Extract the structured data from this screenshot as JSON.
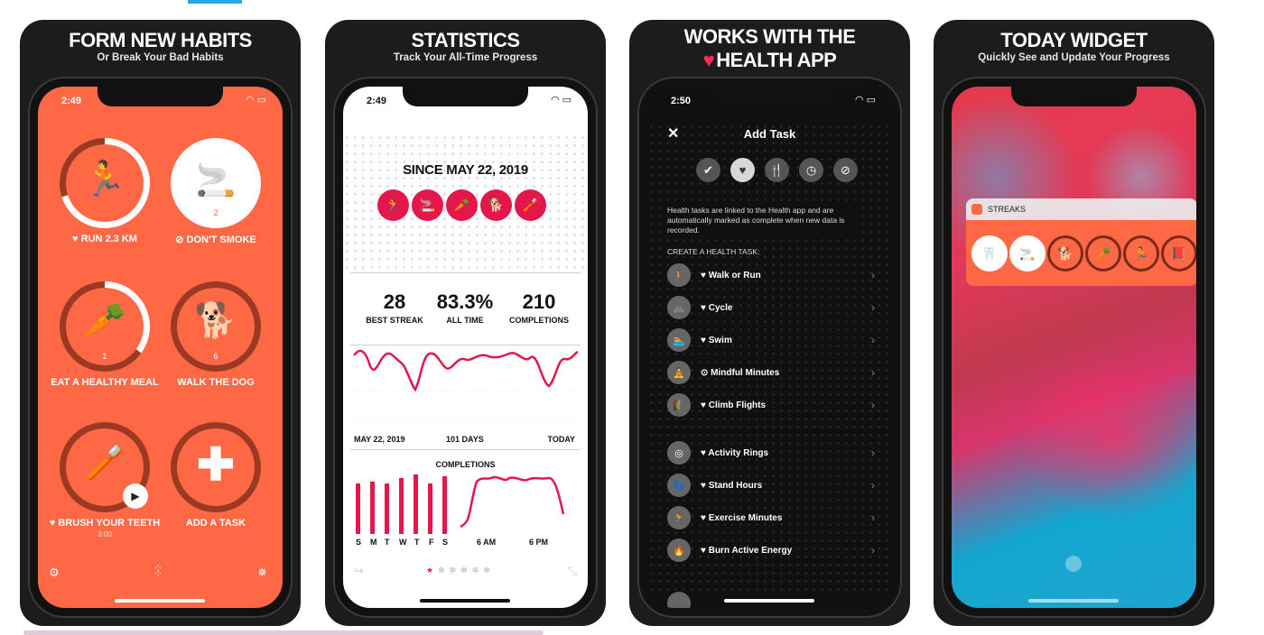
{
  "panels": [
    {
      "title": "FORM NEW HABITS",
      "subtitle": "Or Break Your Bad Habits"
    },
    {
      "title": "STATISTICS",
      "subtitle": "Track Your All-Time Progress"
    },
    {
      "title_line1": "WORKS WITH THE",
      "title_line2": "HEALTH APP"
    },
    {
      "title": "TODAY WIDGET",
      "subtitle": "Quickly See and Update Your Progress"
    }
  ],
  "screen1": {
    "time": "2:49",
    "habits": [
      {
        "label": "RUN 2.3 KM",
        "count": "",
        "glyph": "🏃",
        "progress": 0.7
      },
      {
        "label": "DON'T SMOKE",
        "count": "2",
        "glyph": "🚬",
        "progress": 1.0
      },
      {
        "label": "EAT A HEALTHY MEAL",
        "count": "1",
        "glyph": "🥕",
        "progress": 0.35
      },
      {
        "label": "WALK THE DOG",
        "count": "6",
        "glyph": "🐕",
        "progress": 0.0
      },
      {
        "label": "BRUSH YOUR TEETH",
        "count": "3:00",
        "glyph": "🪥",
        "progress": 0.0
      },
      {
        "label": "ADD A TASK",
        "count": "",
        "glyph": "✚",
        "progress": 0.0
      }
    ]
  },
  "screen2": {
    "time": "2:49",
    "since": "SINCE MAY 22, 2019",
    "stats": [
      {
        "value": "28",
        "label": "BEST STREAK"
      },
      {
        "value": "83.3%",
        "label": "ALL TIME"
      },
      {
        "value": "210",
        "label": "COMPLETIONS"
      }
    ],
    "line_axis": {
      "start": "MAY 22, 2019",
      "middle": "101 DAYS",
      "end": "TODAY"
    },
    "completions_title": "COMPLETIONS",
    "days": [
      "S",
      "M",
      "T",
      "W",
      "T",
      "F",
      "S"
    ],
    "times": [
      "6 AM",
      "6 PM"
    ]
  },
  "screen3": {
    "time": "2:50",
    "title": "Add Task",
    "close": "✕",
    "description": "Health tasks are linked to the Health app and are automatically marked as complete when new data is recorded.",
    "section_header": "CREATE A HEALTH TASK:",
    "rows": [
      {
        "label": "Walk or Run",
        "marker": "♥",
        "icon": "🚶"
      },
      {
        "label": "Cycle",
        "marker": "♥",
        "icon": "🚲"
      },
      {
        "label": "Swim",
        "marker": "♥",
        "icon": "🏊"
      },
      {
        "label": "Mindful Minutes",
        "marker": "⊙",
        "icon": "🧘"
      },
      {
        "label": "Climb Flights",
        "marker": "♥",
        "icon": "🧗"
      },
      {
        "label": "Activity Rings",
        "marker": "♥",
        "icon": "◎"
      },
      {
        "label": "Stand Hours",
        "marker": "♥",
        "icon": "👣"
      },
      {
        "label": "Exercise Minutes",
        "marker": "♥",
        "icon": "🏃"
      },
      {
        "label": "Burn Active Energy",
        "marker": "♥",
        "icon": "🔥"
      }
    ]
  },
  "screen4": {
    "widget_name": "STREAKS"
  },
  "colors": {
    "coral": "#fe6845",
    "streak_red": "#e4174a",
    "health_heart": "#ff2d55"
  }
}
